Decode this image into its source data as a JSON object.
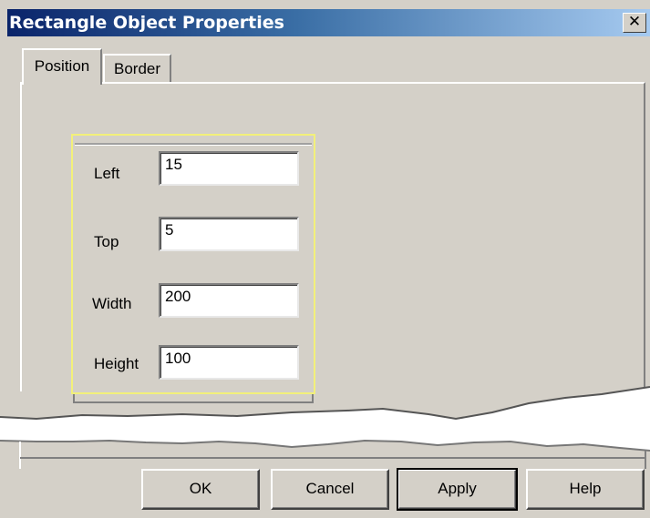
{
  "window": {
    "title": "Rectangle Object Properties",
    "close_symbol": "✕"
  },
  "tabs": [
    {
      "label": "Position",
      "active": true
    },
    {
      "label": "Border",
      "active": false
    }
  ],
  "fields": [
    {
      "label": "Left",
      "value": "15"
    },
    {
      "label": "Top",
      "value": "5"
    },
    {
      "label": "Width",
      "value": "200"
    },
    {
      "label": "Height",
      "value": "100"
    }
  ],
  "buttons": {
    "ok": "OK",
    "cancel": "Cancel",
    "apply": "Apply",
    "help": "Help"
  },
  "colors": {
    "face": "#d4d0c8",
    "title_start": "#0a246a",
    "title_end": "#a6caf0",
    "highlight": "#f2f07a"
  },
  "icons": {
    "close": "close-icon"
  }
}
